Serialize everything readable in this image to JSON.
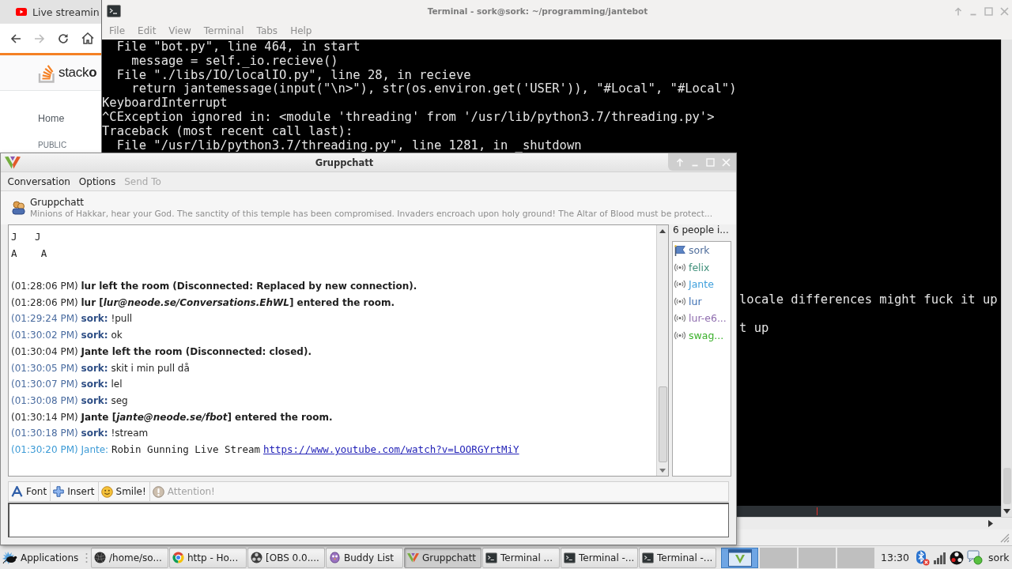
{
  "browser": {
    "tab_title": "Live streamin",
    "logo_text": "stack**o**",
    "nav": [
      {
        "kind": "link",
        "label": "Home"
      },
      {
        "kind": "heading",
        "label": "PUBLIC"
      }
    ]
  },
  "terminal": {
    "title": "Terminal - sork@sork: ~/programming/jantebot",
    "menu": [
      "File",
      "Edit",
      "View",
      "Terminal",
      "Tabs",
      "Help"
    ],
    "lines": [
      "  File \"bot.py\", line 464, in start",
      "    message = self._io.recieve()",
      "  File \"./libs/IO/localIO.py\", line 28, in recieve",
      "    return jantemessage(input(\"\\n>\"), str(os.environ.get('USER')), \"#Local\", \"#Local\")",
      "KeyboardInterrupt",
      "^CException ignored in: <module 'threading' from '/usr/lib/python3.7/threading.py'>",
      "Traceback (most recent call last):",
      "  File \"/usr/lib/python3.7/threading.py\", line 1281, in _shutdown"
    ],
    "partial_lines": [
      "locale differences might fuck it up",
      "t up"
    ]
  },
  "chat": {
    "title": "Gruppchatt",
    "menu": [
      {
        "label": "Conversation",
        "disabled": false
      },
      {
        "label": "Options",
        "disabled": false
      },
      {
        "label": "Send To",
        "disabled": true
      }
    ],
    "room": {
      "name": "Gruppchatt",
      "topic": "Minions of Hakkar, hear your God. The sanctity of this temple has been compromised. Invaders encroach upon holy ground! The Altar of Blood must be protect..."
    },
    "log": [
      {
        "kind": "art",
        "text": "J   J"
      },
      {
        "kind": "art",
        "text": "A    A"
      },
      {
        "kind": "event",
        "time": "(01:28:06 PM)",
        "text": "lur left the room (Disconnected: Replaced by new connection)."
      },
      {
        "kind": "event",
        "time": "(01:28:06 PM)",
        "text": "lur [*lur@neode.se/Conversations.EhWL*] entered the room."
      },
      {
        "kind": "sent",
        "time": "(01:29:24 PM)",
        "sender": "sork:",
        "text": "!pull"
      },
      {
        "kind": "sent",
        "time": "(01:30:02 PM)",
        "sender": "sork:",
        "text": "ok"
      },
      {
        "kind": "event",
        "time": "(01:30:04 PM)",
        "text": "Jante left the room (Disconnected: closed)."
      },
      {
        "kind": "sent",
        "time": "(01:30:05 PM)",
        "sender": "sork:",
        "text": "skit i min pull då"
      },
      {
        "kind": "sent",
        "time": "(01:30:07 PM)",
        "sender": "sork:",
        "text": "lel"
      },
      {
        "kind": "sent",
        "time": "(01:30:08 PM)",
        "sender": "sork:",
        "text": "seg"
      },
      {
        "kind": "event",
        "time": "(01:30:14 PM)",
        "text": "Jante [*jante@neode.se/fbot*] entered the room."
      },
      {
        "kind": "sent",
        "time": "(01:30:18 PM)",
        "sender": "sork:",
        "text": "!stream"
      },
      {
        "kind": "received",
        "time": "(01:30:20 PM)",
        "sender": "Jante:",
        "text": "Robin Gunning Live Stream",
        "link": "https://www.youtube.com/watch?v=LOORGYrtMiY"
      }
    ],
    "occupants": {
      "label": "6 people i...",
      "people": [
        {
          "name": "sork",
          "kind": "owner",
          "color": "#4f6d9b"
        },
        {
          "name": "felix",
          "kind": "member",
          "color": "#3f8f7a"
        },
        {
          "name": "Jante",
          "kind": "member",
          "color": "#40a0dc"
        },
        {
          "name": "lur",
          "kind": "member",
          "color": "#3c6fb3"
        },
        {
          "name": "lur-e6...",
          "kind": "member",
          "color": "#8e6cae"
        },
        {
          "name": "swag...",
          "kind": "member",
          "color": "#39b02a"
        }
      ]
    },
    "toolbar": [
      {
        "kind": "font",
        "label": "Font",
        "disabled": false
      },
      {
        "kind": "insert",
        "label": "Insert",
        "disabled": false
      },
      {
        "kind": "smile",
        "label": "Smile!",
        "disabled": false
      },
      {
        "kind": "attention",
        "label": "Attention!",
        "disabled": true
      }
    ]
  },
  "taskbar": {
    "menu_label": "Applications",
    "tasks": [
      {
        "kind": "files",
        "label": "/home/so...",
        "selected": false
      },
      {
        "kind": "browser",
        "label": "http - Ho...",
        "selected": false
      },
      {
        "kind": "recorder",
        "label": "[OBS 0.0....",
        "selected": false
      },
      {
        "kind": "buddies",
        "label": "Buddy List",
        "selected": false
      },
      {
        "kind": "chat",
        "label": "Gruppchatt",
        "selected": true
      },
      {
        "kind": "terminal",
        "label": "Terminal ...",
        "selected": false
      },
      {
        "kind": "terminal",
        "label": "Terminal -...",
        "selected": false
      },
      {
        "kind": "terminal",
        "label": "Terminal -...",
        "selected": false
      }
    ],
    "workspaces": [
      {
        "selected": true
      },
      {
        "selected": false
      },
      {
        "selected": false
      },
      {
        "selected": false
      }
    ],
    "clock": "13:30",
    "user": "sork"
  }
}
